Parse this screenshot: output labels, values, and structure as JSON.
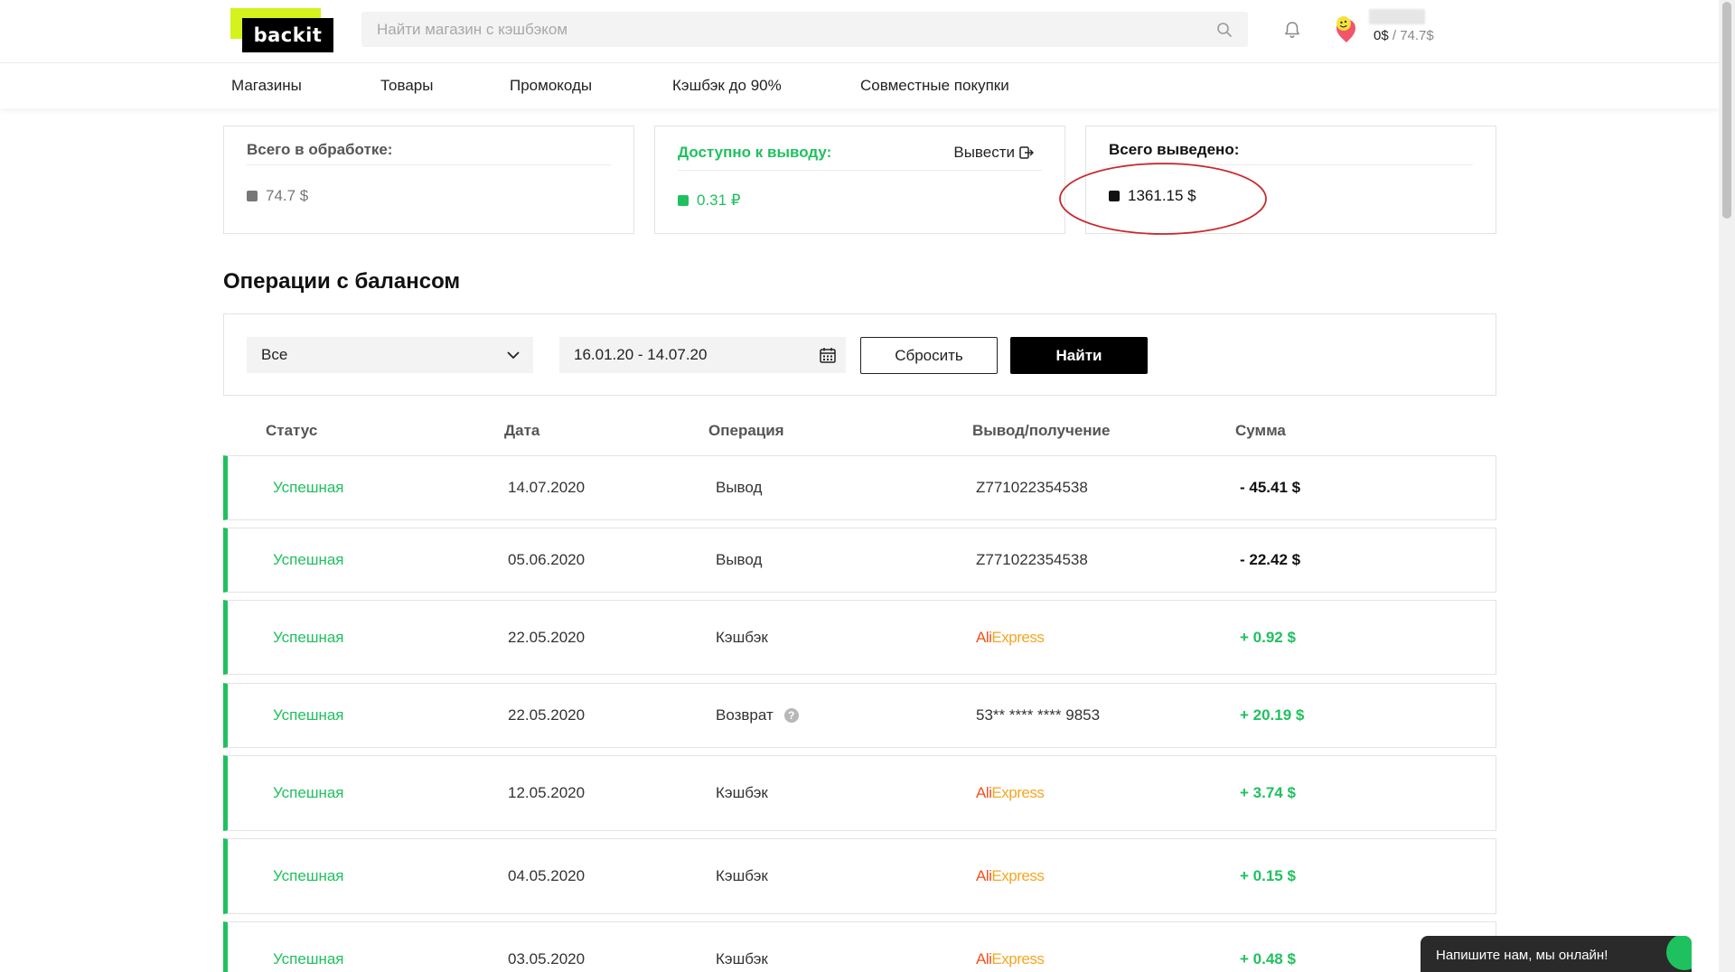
{
  "header": {
    "logo_text": "backit",
    "search_placeholder": "Найти магазин с кэшбэком",
    "balance_current": "0$",
    "balance_separator": " / ",
    "balance_total": "74.7$"
  },
  "nav": {
    "items": [
      "Магазины",
      "Товары",
      "Промокоды",
      "Кэшбэк до 90%",
      "Совместные покупки"
    ]
  },
  "cards": {
    "processing": {
      "title": "Всего в обработке:",
      "value": "74.7 $",
      "color": "#777777"
    },
    "available": {
      "title": "Доступно к выводу:",
      "value": "0.31 ₽",
      "withdraw_label": "Вывести",
      "color": "#1fc15f"
    },
    "withdrawn": {
      "title": "Всего выведено:",
      "value": "1361.15 $",
      "color": "#111111"
    }
  },
  "operations": {
    "title": "Операции с балансом",
    "filter_select": "Все",
    "date_range": "16.01.20 - 14.07.20",
    "reset_label": "Сбросить",
    "find_label": "Найти"
  },
  "table": {
    "headers": [
      "Статус",
      "Дата",
      "Операция",
      "Вывод/получение",
      "Сумма"
    ],
    "rows": [
      {
        "status": "Успешная",
        "date": "14.07.2020",
        "operation": "Вывод",
        "dest": "Z771022354538",
        "sum": "- 45.41 $"
      },
      {
        "status": "Успешная",
        "date": "05.06.2020",
        "operation": "Вывод",
        "dest": "Z771022354538",
        "sum": "- 22.42 $"
      },
      {
        "status": "Успешная",
        "date": "22.05.2020",
        "operation": "Кэшбэк",
        "dest_logo": "AliExpress",
        "sum": "+ 0.92 $"
      },
      {
        "status": "Успешная",
        "date": "22.05.2020",
        "operation": "Возврат",
        "dest": "53** **** **** 9853",
        "sum": "+ 20.19 $"
      },
      {
        "status": "Успешная",
        "date": "12.05.2020",
        "operation": "Кэшбэк",
        "dest_logo": "AliExpress",
        "sum": "+ 3.74 $"
      },
      {
        "status": "Успешная",
        "date": "04.05.2020",
        "operation": "Кэшбэк",
        "dest_logo": "AliExpress",
        "sum": "+ 0.15 $"
      },
      {
        "status": "Успешная",
        "date": "03.05.2020",
        "operation": "Кэшбэк",
        "dest_logo": "AliExpress",
        "sum": "+ 0.48 $"
      }
    ]
  },
  "ali_logo": {
    "part1": "Ali",
    "part2": "Express"
  },
  "chat": {
    "label": "Напишите нам, мы онлайн!"
  },
  "colors": {
    "accent": "#1fc15f",
    "brand": "#d4f21c",
    "highlight": "#c8282d"
  }
}
